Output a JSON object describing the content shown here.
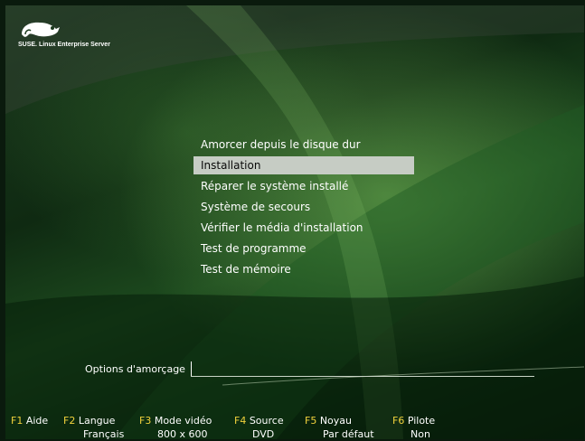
{
  "brand": {
    "logo_text": "SUSE. Linux Enterprise Server"
  },
  "menu": {
    "items": [
      {
        "label": "Amorcer depuis le disque dur",
        "selected": false
      },
      {
        "label": "Installation",
        "selected": true
      },
      {
        "label": "Réparer le système installé",
        "selected": false
      },
      {
        "label": "Système de secours",
        "selected": false
      },
      {
        "label": "Vérifier le média d'installation",
        "selected": false
      },
      {
        "label": "Test de programme",
        "selected": false
      },
      {
        "label": "Test de mémoire",
        "selected": false
      }
    ]
  },
  "boot_options": {
    "label": "Options d'amorçage",
    "value": ""
  },
  "function_keys": [
    {
      "key": "F1",
      "name": "Aide",
      "value": ""
    },
    {
      "key": "F2",
      "name": "Langue",
      "value": "Français"
    },
    {
      "key": "F3",
      "name": "Mode vidéo",
      "value": "800 x 600"
    },
    {
      "key": "F4",
      "name": "Source",
      "value": "DVD"
    },
    {
      "key": "F5",
      "name": "Noyau",
      "value": "Par défaut"
    },
    {
      "key": "F6",
      "name": "Pilote",
      "value": "Non"
    }
  ],
  "colors": {
    "key_accent": "#f2d23c",
    "selection_bg": "#c6ccc4",
    "text": "#ffffff"
  }
}
